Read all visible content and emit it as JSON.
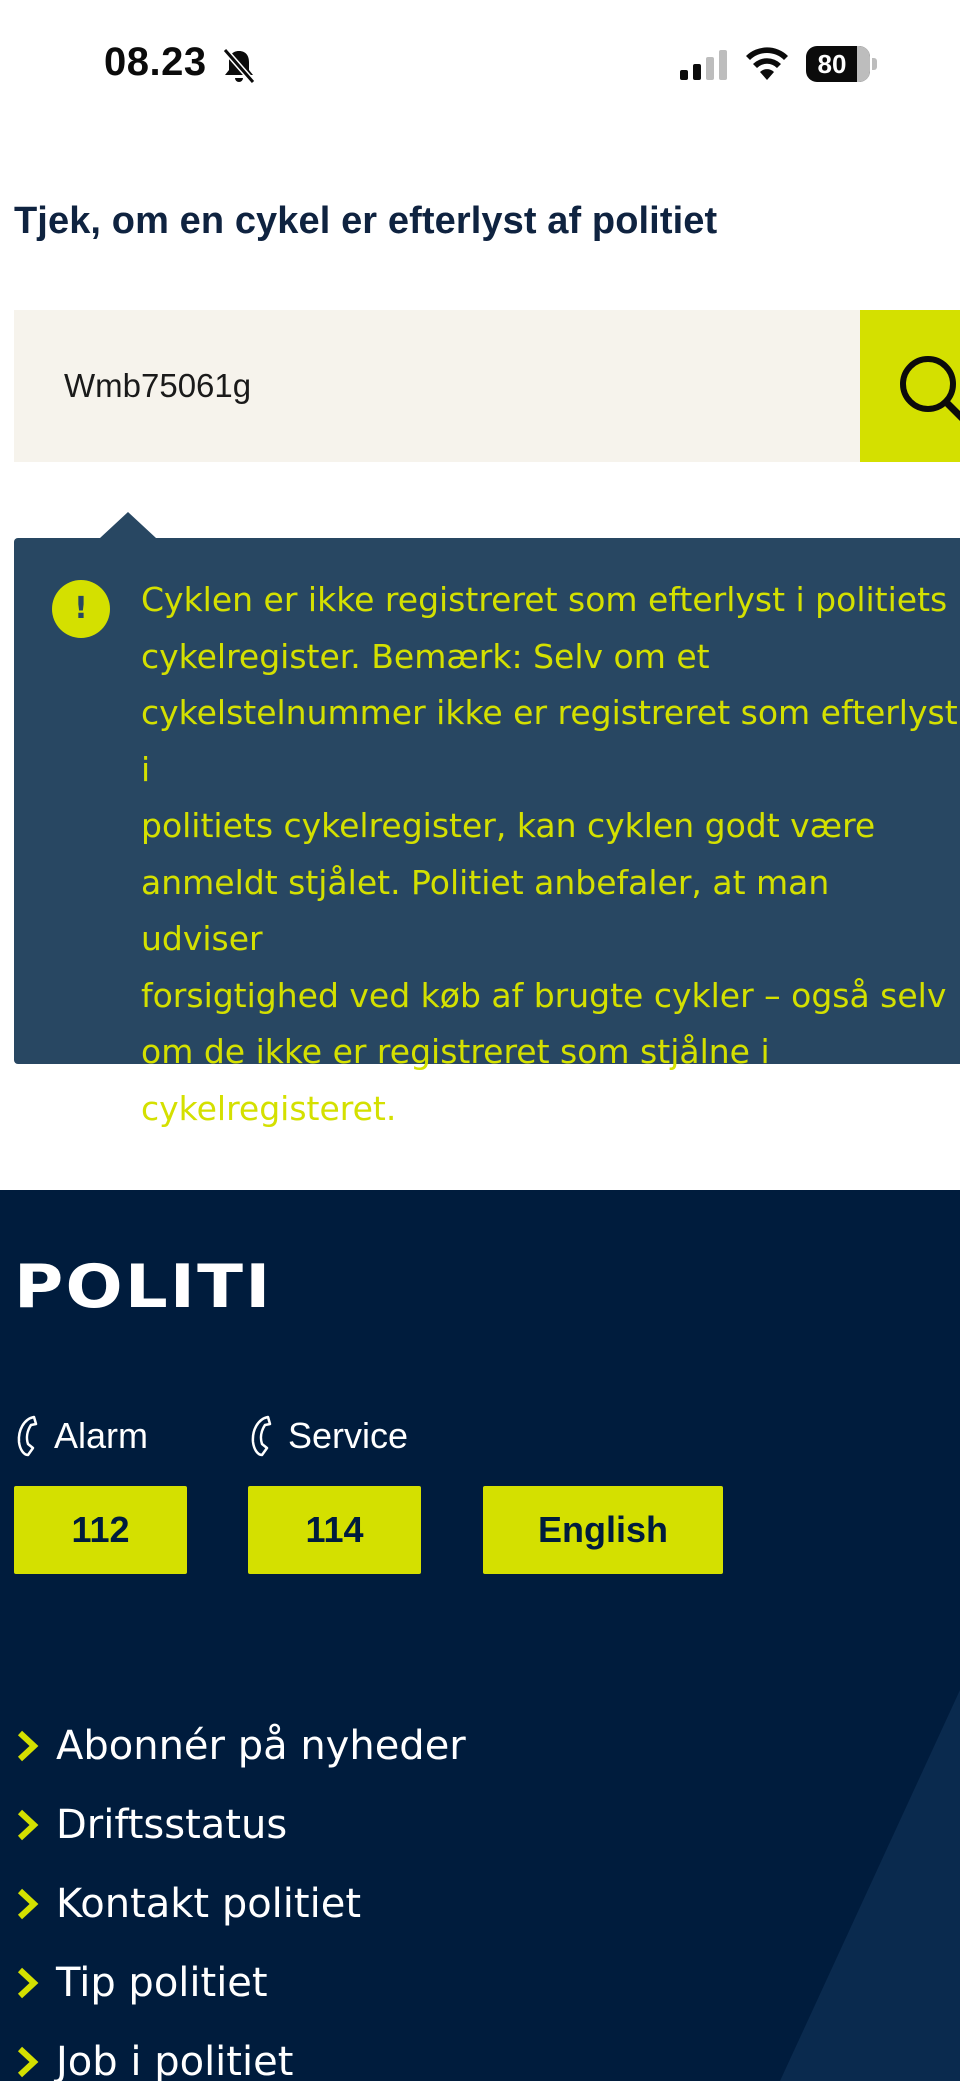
{
  "status_bar": {
    "time": "08.23",
    "battery": "80",
    "battery_level": 0.8
  },
  "page": {
    "title": "Tjek, om en cykel er efterlyst af politiet"
  },
  "search": {
    "value": "Wmb75061g",
    "button_icon": "search-icon"
  },
  "result": {
    "icon": "exclamation-icon",
    "icon_glyph": "!",
    "lines": [
      "Cyklen er ikke registreret som efterlyst i politiets",
      "cykelregister. Bemærk: Selv om et",
      "cykelstelnummer ikke er registreret som efterlyst i",
      "politiets cykelregister, kan cyklen godt være",
      "anmeldt stjålet. Politiet anbefaler, at man udviser",
      "forsigtighed ved køb af brugte cykler – også selv",
      "om de ikke er registreret som stjålne i",
      "cykelregisteret."
    ]
  },
  "footer": {
    "logo_text": "POLITI",
    "alarm_label": "Alarm",
    "service_label": "Service",
    "alarm_number": "112",
    "service_number": "114",
    "english_label": "English",
    "links": [
      "Abonnér på nyheder",
      "Driftsstatus",
      "Kontakt politiet",
      "Tip politiet",
      "Job i politiet"
    ]
  },
  "colors": {
    "navy": "#001c3d",
    "panel": "#284762",
    "accent": "#d4e000",
    "search_bg": "#f6f3ec",
    "title": "#0f2340"
  }
}
